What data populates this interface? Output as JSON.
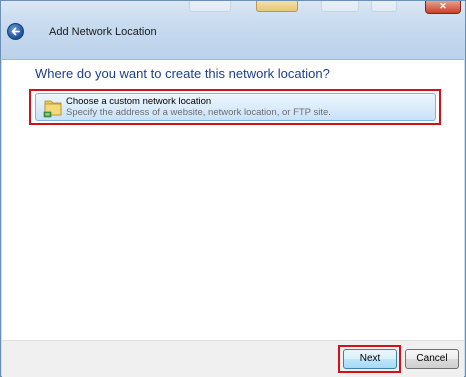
{
  "window": {
    "title": "Add Network Location"
  },
  "icons": {
    "back": "back-arrow-icon",
    "close": "close-icon",
    "folder": "network-folder-icon"
  },
  "main": {
    "heading": "Where do you want to create this network location?",
    "options": [
      {
        "title": "Choose a custom network location",
        "description": "Specify the address of a website, network location, or FTP site."
      }
    ]
  },
  "footer": {
    "next_label": "Next",
    "cancel_label": "Cancel"
  },
  "colors": {
    "heading": "#1e3e8c",
    "highlight_annotation": "#d2111b",
    "option_border": "#7fb3e3"
  }
}
